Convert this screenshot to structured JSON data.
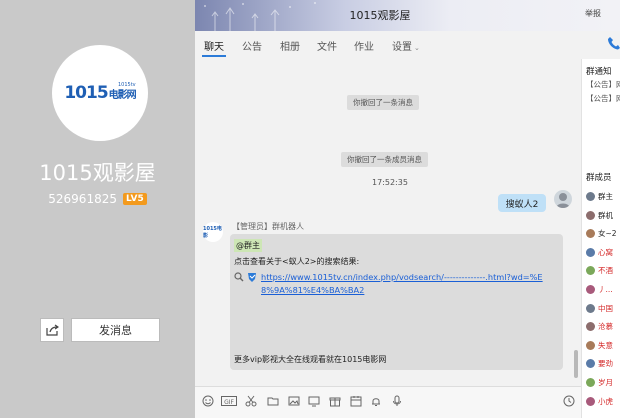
{
  "profile": {
    "logo_text": "1015",
    "logo_cn": "电影网",
    "logo_sub": "1015tv",
    "group_name": "1015观影屋",
    "group_id": "526961825",
    "level": "LV5",
    "send_label": "发消息"
  },
  "header": {
    "title": "1015观影屋",
    "report": "举报"
  },
  "tabs": [
    {
      "label": "聊天"
    },
    {
      "label": "公告"
    },
    {
      "label": "相册"
    },
    {
      "label": "文件"
    },
    {
      "label": "作业"
    },
    {
      "label": "设置"
    }
  ],
  "chat": {
    "system_1": "你撤回了一条消息",
    "system_2": "你撤回了一条成员消息",
    "time": "17:52:35",
    "my_message": "搜蚁人2",
    "bot_sender": "【管理员】群机器人",
    "bot_avatar_text": "1015电影",
    "bot_mention": "@群主",
    "bot_line1": "点击查看关于<蚁人2>的搜索结果:",
    "bot_link": "https://www.1015tv.cn/index.php/vodsearch/--------------.html?wd=%E8%9A%81%E4%BA%BA2",
    "bot_footer": "更多vip影视大全在线观看就在1015电影网"
  },
  "sidebar": {
    "notice_title": "群通知",
    "notice_1": "【公告】网",
    "notice_2": "【公告】网",
    "members_title": "群成员",
    "members": [
      {
        "name": "群主",
        "color": "#222"
      },
      {
        "name": "群机",
        "color": "#222"
      },
      {
        "name": "女~2",
        "color": "#222"
      },
      {
        "name": "心窝",
        "color": "#d42a2a"
      },
      {
        "name": "不酒",
        "color": "#d42a2a"
      },
      {
        "name": "丿...",
        "color": "#d42a2a"
      },
      {
        "name": "中国",
        "color": "#d42a2a"
      },
      {
        "name": "沧慕",
        "color": "#d42a2a"
      },
      {
        "name": "失意",
        "color": "#d42a2a"
      },
      {
        "name": "要劲",
        "color": "#d42a2a"
      },
      {
        "name": "岁月",
        "color": "#d42a2a"
      },
      {
        "name": "小虎",
        "color": "#d42a2a"
      }
    ]
  },
  "colors": {
    "accent": "#2c7bd8",
    "level_badge": "#f39a1d",
    "link": "#1a5fd6",
    "left_panel": "#c9c9c9"
  }
}
